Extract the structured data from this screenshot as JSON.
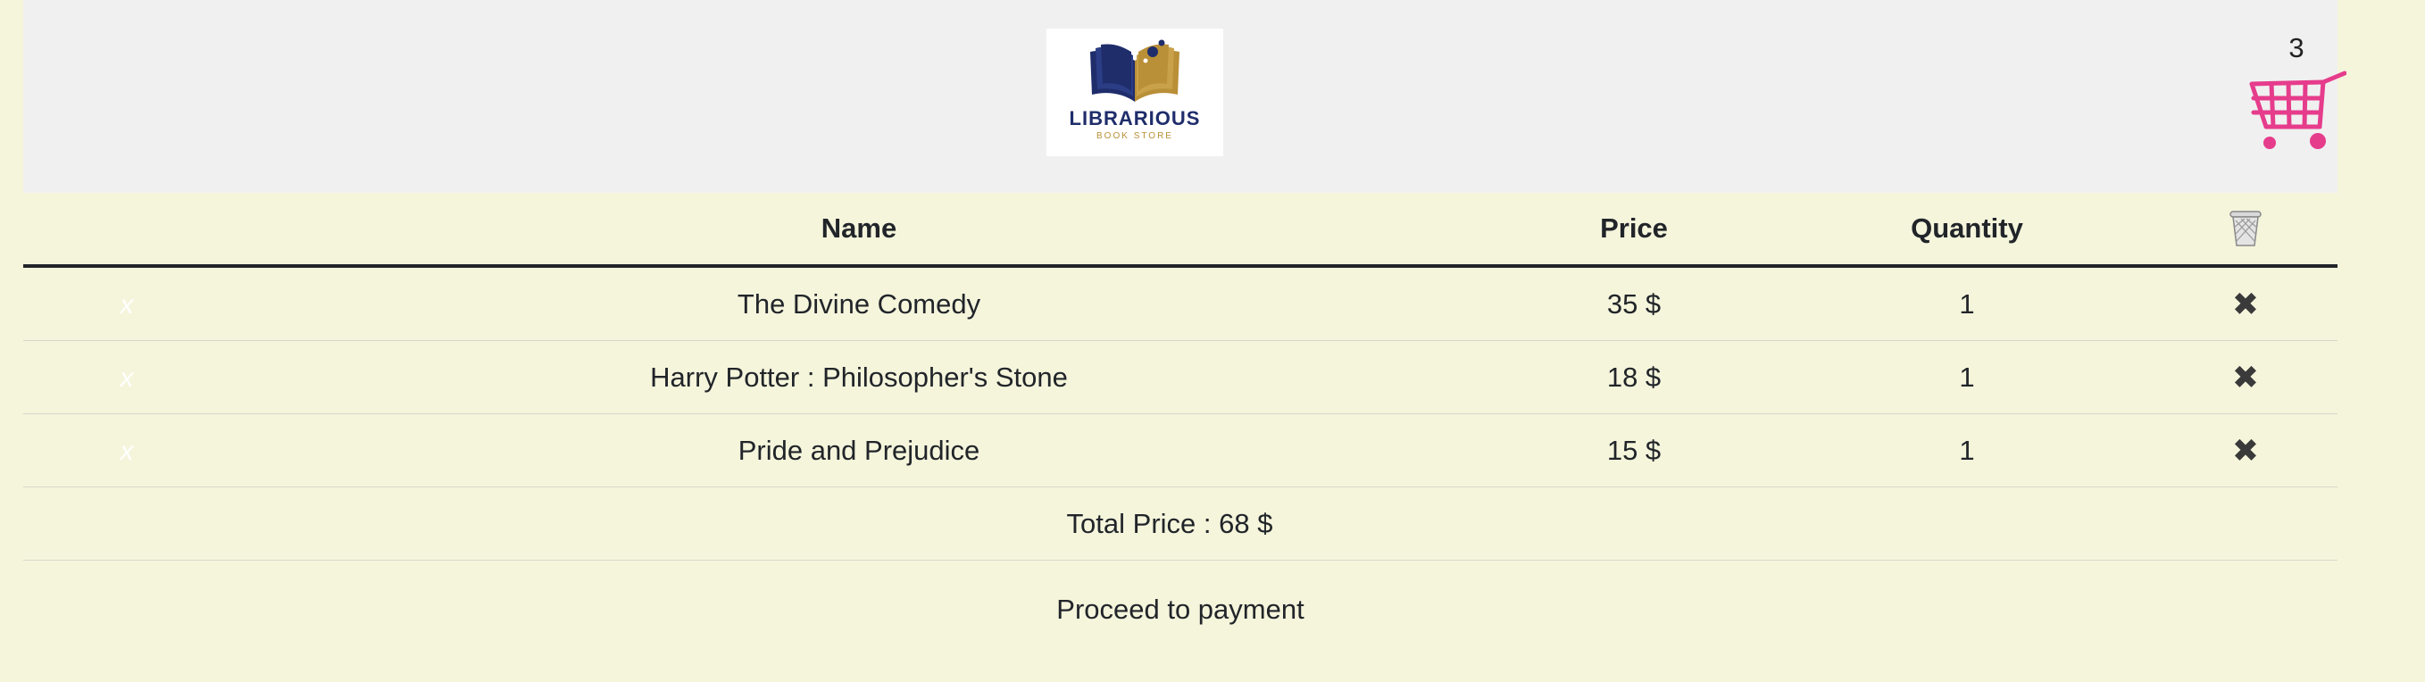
{
  "brand": {
    "name": "LIBRARIOUS",
    "tagline": "BOOK STORE",
    "colors": {
      "navy": "#1f2d6b",
      "gold": "#b98f37"
    }
  },
  "cart": {
    "count": "3",
    "icon": "shopping-cart-icon",
    "icon_color": "#e63c8c"
  },
  "table": {
    "headers": {
      "name": "Name",
      "price": "Price",
      "quantity": "Quantity"
    },
    "header_icon": "trash-icon",
    "rows": [
      {
        "remove": "x",
        "name": "The Divine Comedy",
        "price": "35 $",
        "quantity": "1",
        "delete": "✖"
      },
      {
        "remove": "x",
        "name": "Harry Potter : Philosopher's Stone",
        "price": "18 $",
        "quantity": "1",
        "delete": "✖"
      },
      {
        "remove": "x",
        "name": "Pride and Prejudice",
        "price": "15 $",
        "quantity": "1",
        "delete": "✖"
      }
    ],
    "total": "Total Price : 68 $"
  },
  "payment": {
    "label": "Proceed to payment"
  },
  "colors": {
    "background": "#f5f5dc",
    "header": "#f0f0f0"
  }
}
